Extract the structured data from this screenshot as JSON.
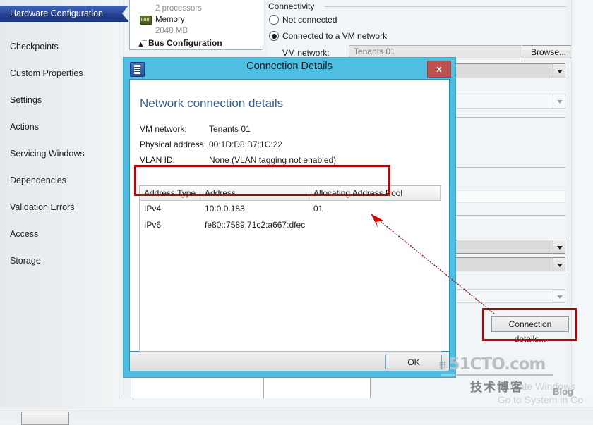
{
  "sidebar": {
    "items": [
      {
        "label": "Hardware Configuration",
        "selected": true
      },
      {
        "label": "Checkpoints",
        "selected": false
      },
      {
        "label": "Custom Properties",
        "selected": false
      },
      {
        "label": "Settings",
        "selected": false
      },
      {
        "label": "Actions",
        "selected": false
      },
      {
        "label": "Servicing Windows",
        "selected": false
      },
      {
        "label": "Dependencies",
        "selected": false
      },
      {
        "label": "Validation Errors",
        "selected": false
      },
      {
        "label": "Access",
        "selected": false
      },
      {
        "label": "Storage",
        "selected": false
      }
    ]
  },
  "hardware_panel": {
    "processors_sub": "2 processors",
    "memory_label": "Memory",
    "memory_sub": "2048 MB",
    "bus_group": "Bus Configuration"
  },
  "connectivity": {
    "group_title": "Connectivity",
    "option_not_connected": "Not connected",
    "option_connected": "Connected to a VM network",
    "selected_option": "Connected to a VM network",
    "vm_network_label": "VM network:",
    "vm_network_value": "Tenants 01",
    "browse_button": "Browse...",
    "connection_details_button": "Connection details..."
  },
  "dialog": {
    "title": "Connection Details",
    "close_label": "x",
    "heading": "Network connection details",
    "details": [
      {
        "label": "VM network:",
        "value": "Tenants 01"
      },
      {
        "label": "Physical address:",
        "value": "00:1D:D8:B7:1C:22"
      },
      {
        "label": "VLAN ID:",
        "value": "None (VLAN tagging not enabled)"
      }
    ],
    "table": {
      "columns": [
        "Address Type",
        "Address",
        "Allocating Address Pool"
      ],
      "rows": [
        {
          "type": "IPv4",
          "address": "10.0.0.183",
          "pool": "01"
        },
        {
          "type": "IPv6",
          "address": "fe80::7589:71c2:a667:dfec",
          "pool": ""
        }
      ]
    },
    "ok_button": "OK"
  },
  "watermark": {
    "main": "51CTO.com",
    "sub": "技术博客",
    "blog": "Blog"
  },
  "activation": {
    "line1": "Activate Windows",
    "line2": "Go to System in Co"
  },
  "colors": {
    "accent_blue": "#4fbee3",
    "selected_nav": "#24408e",
    "annotation_red": "#c00000",
    "heading_blue": "#2f5d96",
    "close_red": "#c0504d"
  }
}
